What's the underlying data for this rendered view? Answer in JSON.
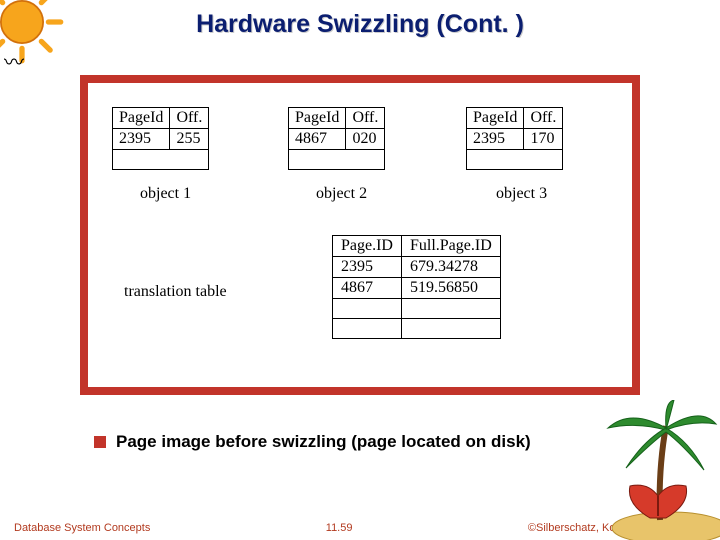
{
  "title": "Hardware Swizzling (Cont. )",
  "objects": {
    "headers": {
      "page": "PageId",
      "off": "Off."
    },
    "items": [
      {
        "page": "2395",
        "off": "255",
        "label": "object 1"
      },
      {
        "page": "4867",
        "off": "020",
        "label": "object 2"
      },
      {
        "page": "2395",
        "off": "170",
        "label": "object 3"
      }
    ]
  },
  "translation": {
    "label": "translation table",
    "headers": {
      "page": "Page.ID",
      "full": "Full.Page.ID"
    },
    "rows": [
      {
        "page": "2395",
        "full": "679.34278"
      },
      {
        "page": "4867",
        "full": "519.56850"
      }
    ]
  },
  "bullet": "Page image before swizzling (page located on disk)",
  "footer": {
    "left": "Database System Concepts",
    "center": "11.59",
    "right": "©Silberschatz, Korth and Sudarshan"
  }
}
